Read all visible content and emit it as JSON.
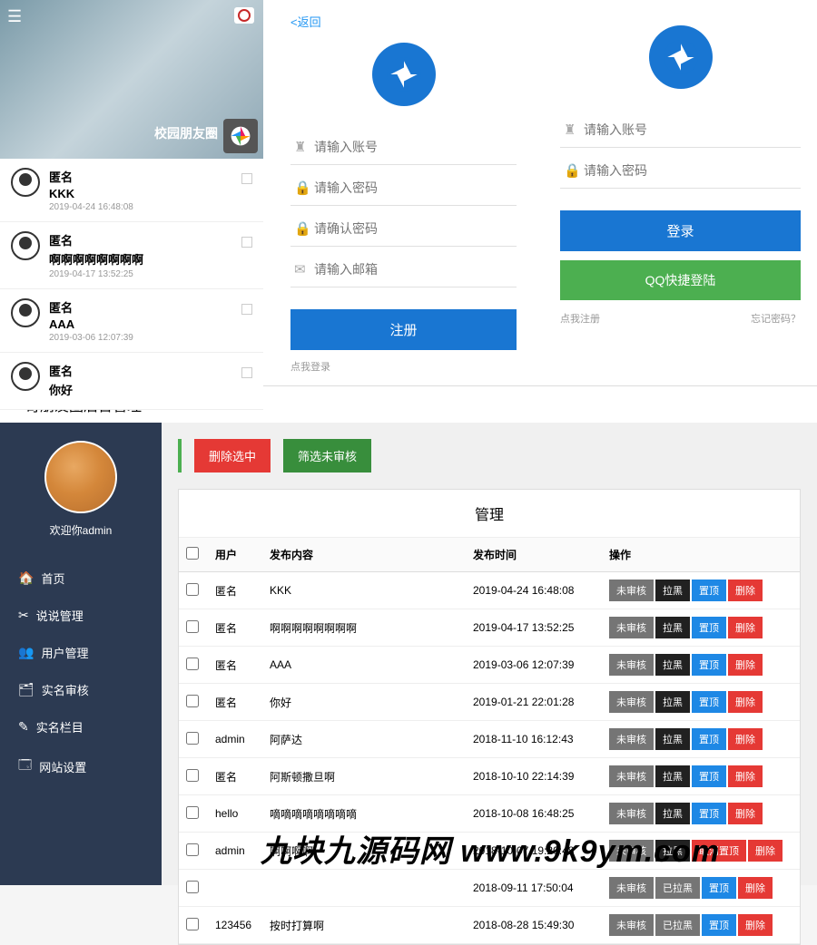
{
  "feed": {
    "title": "校园朋友圈",
    "items": [
      {
        "user": "匿名",
        "text": "KKK",
        "time": "2019-04-24 16:48:08"
      },
      {
        "user": "匿名",
        "text": "啊啊啊啊啊啊啊啊",
        "time": "2019-04-17 13:52:25"
      },
      {
        "user": "匿名",
        "text": "AAA",
        "time": "2019-03-06 12:07:39"
      },
      {
        "user": "匿名",
        "text": "你好",
        "time": ""
      }
    ]
  },
  "register": {
    "back": "<返回",
    "account_ph": "请输入账号",
    "password_ph": "请输入密码",
    "confirm_ph": "请确认密码",
    "email_ph": "请输入邮箱",
    "submit": "注册",
    "login_link": "点我登录"
  },
  "login": {
    "account_ph": "请输入账号",
    "password_ph": "请输入密码",
    "submit": "登录",
    "qq": "QQ快捷登陆",
    "register_link": "点我注册",
    "forgot": "忘记密码？"
  },
  "admin": {
    "titlebar": "一奇朋友圈后台管理",
    "welcome": "欢迎你admin",
    "nav": [
      {
        "icon": "🏠",
        "label": "首页"
      },
      {
        "icon": "✂",
        "label": "说说管理"
      },
      {
        "icon": "👥",
        "label": "用户管理"
      },
      {
        "icon": "🗂",
        "label": "实名审核"
      },
      {
        "icon": "✎",
        "label": "实名栏目"
      },
      {
        "icon": "🗔",
        "label": "网站设置"
      }
    ],
    "delete_selected": "删除选中",
    "filter_pending": "筛选未审核",
    "table_title": "管理",
    "headers": {
      "user": "用户",
      "content": "发布内容",
      "time": "发布时间",
      "ops": "操作"
    },
    "rows": [
      {
        "user": "匿名",
        "content": "KKK",
        "time": "2019-04-24 16:48:08",
        "ops": [
          "未审核",
          "拉黑",
          "置顶",
          "删除"
        ],
        "cls": [
          "b-gray",
          "b-black",
          "b-blue",
          "b-red"
        ]
      },
      {
        "user": "匿名",
        "content": "啊啊啊啊啊啊啊啊",
        "time": "2019-04-17 13:52:25",
        "ops": [
          "未审核",
          "拉黑",
          "置顶",
          "删除"
        ],
        "cls": [
          "b-gray",
          "b-black",
          "b-blue",
          "b-red"
        ]
      },
      {
        "user": "匿名",
        "content": "AAA",
        "time": "2019-03-06 12:07:39",
        "ops": [
          "未审核",
          "拉黑",
          "置顶",
          "删除"
        ],
        "cls": [
          "b-gray",
          "b-black",
          "b-blue",
          "b-red"
        ]
      },
      {
        "user": "匿名",
        "content": "你好",
        "time": "2019-01-21 22:01:28",
        "ops": [
          "未审核",
          "拉黑",
          "置顶",
          "删除"
        ],
        "cls": [
          "b-gray",
          "b-black",
          "b-blue",
          "b-red"
        ]
      },
      {
        "user": "admin",
        "content": "阿萨达",
        "time": "2018-11-10 16:12:43",
        "ops": [
          "未审核",
          "拉黑",
          "置顶",
          "删除"
        ],
        "cls": [
          "b-gray",
          "b-black",
          "b-blue",
          "b-red"
        ]
      },
      {
        "user": "匿名",
        "content": "阿斯顿撒旦啊",
        "time": "2018-10-10 22:14:39",
        "ops": [
          "未审核",
          "拉黑",
          "置顶",
          "删除"
        ],
        "cls": [
          "b-gray",
          "b-black",
          "b-blue",
          "b-red"
        ]
      },
      {
        "user": "hello",
        "content": "嘀嘀嘀嘀嘀嘀嘀嘀",
        "time": "2018-10-08 16:48:25",
        "ops": [
          "未审核",
          "拉黑",
          "置顶",
          "删除"
        ],
        "cls": [
          "b-gray",
          "b-black",
          "b-blue",
          "b-red"
        ]
      },
      {
        "user": "admin",
        "content": "啊啊啊啊",
        "time": "2018-10-07 19:20:48",
        "ops": [
          "未审核",
          "拉黑",
          "取消置顶",
          "删除"
        ],
        "cls": [
          "b-gray",
          "b-black",
          "b-red",
          "b-red"
        ]
      },
      {
        "user": "",
        "content": "",
        "time": "2018-09-11 17:50:04",
        "ops": [
          "未审核",
          "已拉黑",
          "置顶",
          "删除"
        ],
        "cls": [
          "b-gray",
          "b-gray",
          "b-blue",
          "b-red"
        ]
      },
      {
        "user": "123456",
        "content": "按时打算啊",
        "time": "2018-08-28 15:49:30",
        "ops": [
          "未审核",
          "已拉黑",
          "置顶",
          "删除"
        ],
        "cls": [
          "b-gray",
          "b-gray",
          "b-blue",
          "b-red"
        ]
      }
    ]
  },
  "watermark": "九块九源码网 www.9k9ym.com"
}
